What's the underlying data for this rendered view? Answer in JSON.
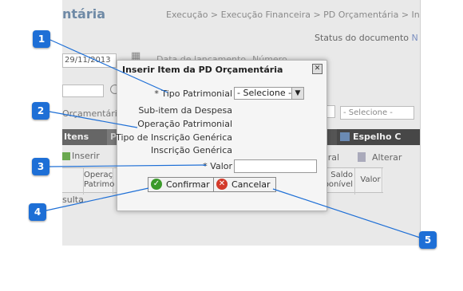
{
  "background": {
    "page_title": "ntária",
    "breadcrumb": "Execução > Execução Financeira > PD Orçamentária > Inserir I",
    "status_label": "Status do documento",
    "status_value": "N",
    "date_value": "29/11/2013",
    "date_label": "Data de lançamento",
    "number_label": "Número",
    "orc_label": "Orçamentária",
    "select_value": "- Selecione -",
    "tabs": {
      "itens": "Itens",
      "p": "P",
      "espelho": "Espelho C"
    },
    "toolbar": {
      "inserir": "Inserir",
      "integral": "egral",
      "alterar": "Alterar"
    },
    "grid": {
      "col1": "",
      "col2": "Operaç Patrimo",
      "col_saldo": "Saldo ponível",
      "col_valor": "Valor"
    },
    "consulta": "sulta."
  },
  "modal": {
    "title": "Inserir Item da PD Orçamentária",
    "close_label": "✕",
    "fields": {
      "tipo_patrimonial": "* Tipo Patrimonial",
      "tipo_patrimonial_value": "- Selecione -",
      "subitem": "Sub-item da Despesa",
      "operacao": "Operação Patrimonial",
      "tipo_inscricao": "Tipo de Inscrição Genérica",
      "inscricao": "Inscrição Genérica",
      "valor": "* Valor"
    },
    "buttons": {
      "confirmar": "Confirmar",
      "cancelar": "Cancelar"
    }
  },
  "callouts": [
    "1",
    "2",
    "3",
    "4",
    "5"
  ],
  "colors": {
    "callout": "#1e6fd6",
    "confirm": "#3a9a2a",
    "cancel": "#d33a2a"
  }
}
